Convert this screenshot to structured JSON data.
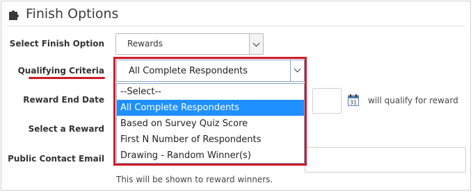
{
  "section": {
    "title": "Finish Options",
    "icon": "puzzle-icon"
  },
  "fields": {
    "finish_option_label": "Select Finish Option",
    "finish_option_value": "Rewards",
    "qualifying_criteria_label": "Qualifying Criteria",
    "qualifying_criteria_value": "All Complete Respondents",
    "reward_end_date_label": "Reward End Date",
    "reward_end_date_value": "",
    "qualify_text": "will qualify for reward",
    "select_reward_label": "Select a Reward",
    "public_contact_email_label": "Public Contact Email",
    "public_contact_email_value": "",
    "public_contact_hint": "This will be shown to reward winners."
  },
  "dropdown": {
    "options": [
      "--Select--",
      "All Complete Respondents",
      "Based on Survey Quiz Score",
      "First N Number of Respondents",
      "Drawing - Random Winner(s)"
    ],
    "selected_index": 1
  },
  "colors": {
    "highlight": "#d11a26",
    "selected_option": "#1e90ff"
  }
}
